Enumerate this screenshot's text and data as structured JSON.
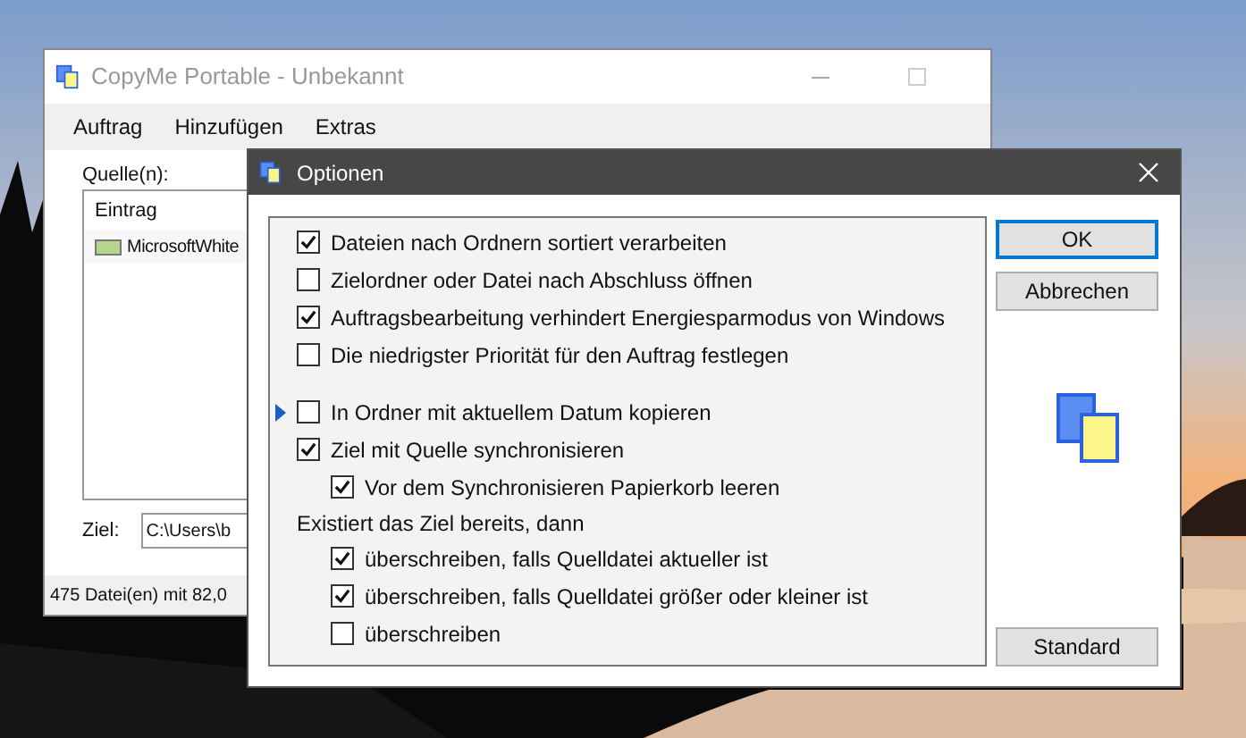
{
  "main_window": {
    "title": "CopyMe Portable - Unbekannt",
    "menu": [
      "Auftrag",
      "Hinzufügen",
      "Extras"
    ],
    "sources_label": "Quelle(n):",
    "list": {
      "column_1": "Eintrag",
      "rows": [
        {
          "color": "#b5d58e",
          "text": "MicrosoftWhite"
        }
      ]
    },
    "target_label": "Ziel:",
    "target_value": "C:\\Users\\b",
    "status_bar": "475 Datei(en) mit 82,0"
  },
  "dialog": {
    "title": "Optionen",
    "option_groups": [
      {
        "items": [
          {
            "kind": "checkbox",
            "label": "Dateien nach Ordnern sortiert verarbeiten",
            "checked": true,
            "focused": false
          },
          {
            "kind": "checkbox",
            "label": "Zielordner oder Datei nach Abschluss öffnen",
            "checked": false,
            "focused": false
          },
          {
            "kind": "checkbox",
            "label": "Auftragsbearbeitung verhindert Energiesparmodus von Windows",
            "checked": true,
            "focused": false
          },
          {
            "kind": "checkbox",
            "label": "Die niedrigster Priorität für den Auftrag festlegen",
            "checked": false,
            "focused": false
          }
        ]
      },
      {
        "items": [
          {
            "kind": "checkbox",
            "label": "In Ordner mit aktuellem Datum kopieren",
            "checked": false,
            "focused": true
          },
          {
            "kind": "checkbox",
            "label": "Ziel mit Quelle synchronisieren",
            "checked": true,
            "focused": false,
            "children": [
              {
                "kind": "checkbox",
                "label": "Vor dem Synchronisieren Papierkorb leeren",
                "checked": true,
                "focused": false
              }
            ]
          },
          {
            "kind": "label",
            "label": "Existiert das Ziel bereits, dann",
            "children": [
              {
                "kind": "checkbox",
                "label": "überschreiben, falls Quelldatei aktueller ist",
                "checked": true,
                "focused": false
              },
              {
                "kind": "checkbox",
                "label": "überschreiben, falls Quelldatei größer oder kleiner ist",
                "checked": true,
                "focused": false
              },
              {
                "kind": "checkbox",
                "label": "überschreiben",
                "checked": false,
                "focused": false
              }
            ]
          }
        ]
      }
    ],
    "buttons": [
      {
        "label": "OK",
        "default": true
      },
      {
        "label": "Abbrechen",
        "default": false
      }
    ],
    "reset_button": "Standard"
  }
}
